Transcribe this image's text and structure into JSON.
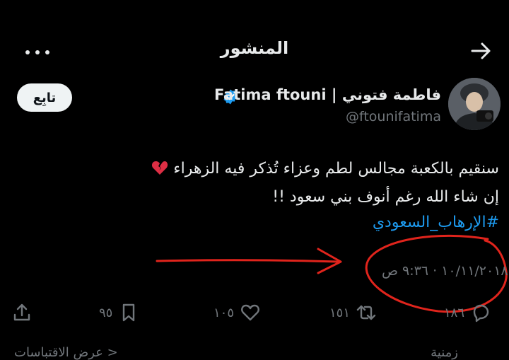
{
  "header": {
    "title": "المنشور"
  },
  "author": {
    "name": "Fatima ftouni | فاطمة فتوني",
    "handle": "@ftounifatima",
    "follow_label": "تابِع"
  },
  "tweet": {
    "line1": "سنقيم بالكعبة مجالس لطم وعزاء تُذكر فيه الزهراء",
    "line2": "إن شاء الله رغم أنوف بني سعود !!",
    "hashtag": "#الإرهاب_السعودي",
    "timestamp": "١٠/١١/٢٠١٨ · ٩:٣٦ ص"
  },
  "actions": {
    "replies": "١٨٦",
    "retweets": "١٥١",
    "likes": "١٠٥",
    "bookmarks": "٩٥"
  },
  "footer": {
    "right_text": "زمنية",
    "left_text": "عرض الاقتباسات >"
  },
  "colors": {
    "accent": "#1d9bf0",
    "annotation_red": "#e0241c",
    "background": "#000000",
    "muted": "#71767b"
  },
  "icons": [
    "back-arrow-icon",
    "more-icon",
    "verified-badge-icon",
    "broken-heart-icon",
    "reply-icon",
    "retweet-icon",
    "like-icon",
    "bookmark-icon",
    "share-icon"
  ]
}
